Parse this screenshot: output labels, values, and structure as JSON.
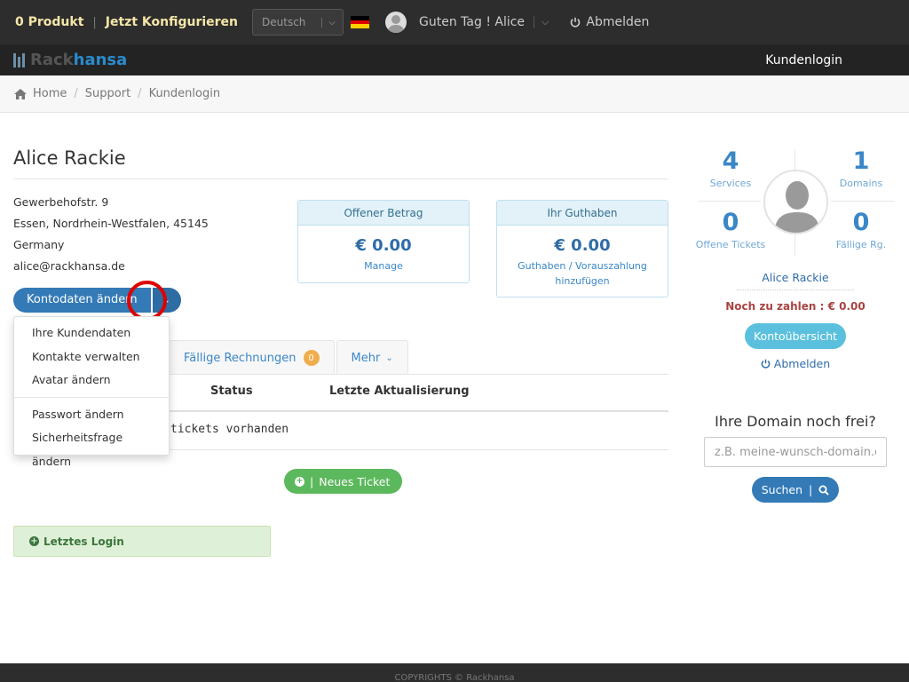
{
  "topbar": {
    "product_count": "0 Produkt",
    "configure": "Jetzt Konfigurieren",
    "language": "Deutsch",
    "greeting": "Guten Tag ! Alice",
    "logout": "Abmelden"
  },
  "brand": {
    "rack": "Rack",
    "hansa": "hansa"
  },
  "nav": {
    "kundenlogin": "Kundenlogin"
  },
  "breadcrumb": [
    "Home",
    "Support",
    "Kundenlogin"
  ],
  "page": {
    "title": "Alice Rackie",
    "address": [
      "Gewerbehofstr. 9",
      "Essen, Nordrhein-Westfalen, 45145",
      "Germany",
      "alice@rackhansa.de"
    ]
  },
  "cards": {
    "open_amount": {
      "title": "Offener Betrag",
      "amount": "€ 0.00",
      "link": "Manage"
    },
    "credit": {
      "title": "Ihr Guthaben",
      "amount": "€ 0.00",
      "link": "Guthaben / Vorauszahlung hinzufügen"
    }
  },
  "account_button": {
    "label": "Kontodaten ändern"
  },
  "dropdown": {
    "items": [
      "Ihre Kundendaten",
      "Kontakte verwalten",
      "Avatar ändern",
      "Passwort ändern",
      "Sicherheitsfrage ändern"
    ]
  },
  "tabs": {
    "invoices": "Fällige Rechnungen",
    "invoices_badge": "0",
    "more": "Mehr"
  },
  "table": {
    "headers": {
      "status": "Status",
      "updated": "Letzte Aktualisierung"
    },
    "empty": "tickets vorhanden"
  },
  "new_ticket": {
    "label": "Neues Ticket"
  },
  "last_login": {
    "label": "Letztes Login"
  },
  "sidebar": {
    "stats": [
      {
        "value": "4",
        "label": "Services"
      },
      {
        "value": "1",
        "label": "Domains"
      },
      {
        "value": "0",
        "label": "Offene Tickets"
      },
      {
        "value": "0",
        "label": "Fällige Rg."
      }
    ],
    "name": "Alice Rackie",
    "due": "Noch zu zahlen : € 0.00",
    "overview_button": "Kontoübersicht",
    "logout": "Abmelden"
  },
  "domain": {
    "title": "Ihre Domain noch frei?",
    "placeholder": "z.B. meine-wunsch-domain.de",
    "search": "Suchen"
  },
  "footer": {
    "text": "COPYRIGHTS © Rackhansa"
  },
  "colors": {
    "primary": "#337ab7",
    "success": "#5cb85c",
    "info": "#5bc0de",
    "warning": "#f0ad4e",
    "highlight": "#e00000"
  }
}
